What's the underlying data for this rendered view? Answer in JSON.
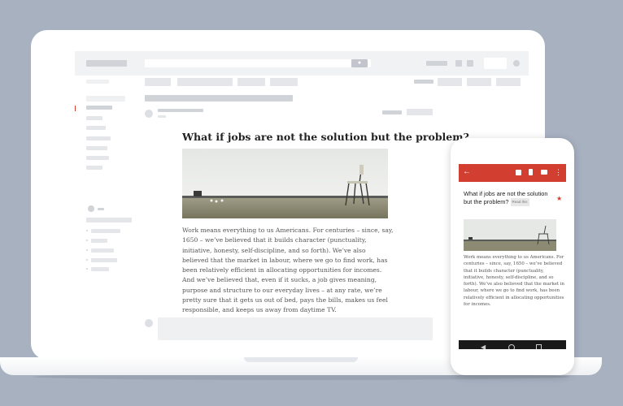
{
  "laptop": {
    "search_button_icon": "search-icon",
    "email": {
      "subject": "What if jobs are not the solution but the problem?",
      "body": "Work means everything to us Americans. For centuries – since, say, 1650 – we’ve believed that it builds character (punctuality, initiative, honesty, self-discipline, and so forth). We’ve also believed that the market in labour, where we go to find work, has been relatively efficient in allocating opportunities for incomes. And we’ve believed that, even if it sucks, a job gives meaning, purpose and structure to our everyday lives – at any rate, we’re pretty sure that it gets us out of bed, pays the bills, makes us feel responsible, and keeps us away from daytime TV."
    }
  },
  "phone": {
    "appbar_color": "#d23f31",
    "subject": "What if jobs are not the solution but the problem?",
    "tag": "Read this",
    "star_color": "#d23f31",
    "body": "Work means everything to us Americans. For centuries – since, say, 1650 – we’ve believed that it builds character (punctuality, initiative, honesty, self-discipline, and so forth). We’ve also believed that the market in labour, where we go to find work, has been relatively efficient in allocating opportunities for incomes."
  }
}
